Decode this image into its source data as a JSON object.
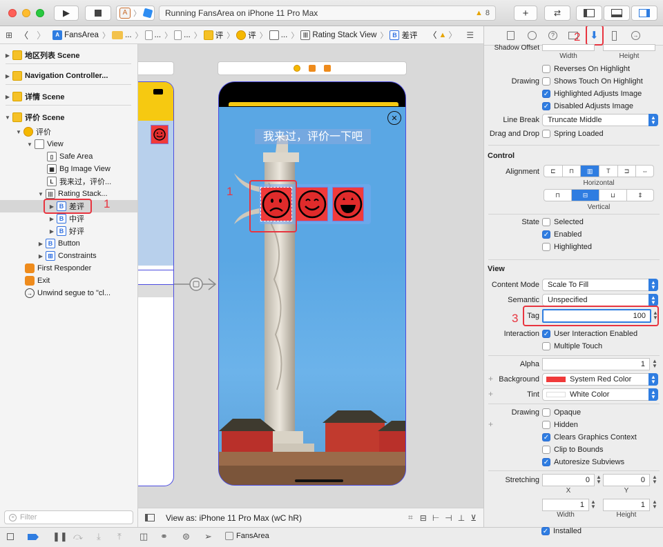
{
  "window": {
    "activity": "Running FansArea on iPhone 11 Pro Max",
    "warning_count": "8"
  },
  "jumpbar": {
    "items": [
      "FansArea",
      "...",
      "...",
      "...",
      "评",
      "评",
      "...",
      "Rating Stack View",
      "差评"
    ]
  },
  "outline": {
    "scenes": [
      "地区列表 Scene",
      "Navigation Controller...",
      "详情 Scene",
      "评价 Scene"
    ],
    "controller": "评价",
    "view": "View",
    "safe_area": "Safe Area",
    "bg_image": "Bg Image View",
    "label": "我来过，评价...",
    "stack": "Rating Stack...",
    "buttons": [
      "差评",
      "中评",
      "好评"
    ],
    "button": "Button",
    "constraints": "Constraints",
    "first_responder": "First Responder",
    "exit": "Exit",
    "unwind": "Unwind segue to \"cl...",
    "filter_placeholder": "Filter"
  },
  "canvas": {
    "view_as": "View as: iPhone 11 Pro Max (wC hR)",
    "title_label": "我来过，评价一下吧",
    "close_glyph": "✕"
  },
  "annotations": [
    "1",
    "1",
    "2",
    "3"
  ],
  "inspector": {
    "top": {
      "shadow_offset": "Shadow Offset",
      "width_cap": "Width",
      "height_cap": "Height"
    },
    "reverses": "Reverses On Highlight",
    "drawing_label": "Drawing",
    "shows_touch": "Shows Touch On Highlight",
    "highlighted_adjusts": "Highlighted Adjusts Image",
    "disabled_adjusts": "Disabled Adjusts Image",
    "line_break_label": "Line Break",
    "line_break": "Truncate Middle",
    "drag_drop_label": "Drag and Drop",
    "spring_loaded": "Spring Loaded",
    "control_title": "Control",
    "alignment_label": "Alignment",
    "horizontal_cap": "Horizontal",
    "vertical_cap": "Vertical",
    "state_label": "State",
    "selected": "Selected",
    "enabled": "Enabled",
    "highlighted": "Highlighted",
    "view_title": "View",
    "content_mode_label": "Content Mode",
    "content_mode": "Scale To Fill",
    "semantic_label": "Semantic",
    "semantic": "Unspecified",
    "tag_label": "Tag",
    "tag": "100",
    "interaction_label": "Interaction",
    "user_interaction": "User Interaction Enabled",
    "multiple_touch": "Multiple Touch",
    "alpha_label": "Alpha",
    "alpha": "1",
    "background_label": "Background",
    "background": "System Red Color",
    "tint_label": "Tint",
    "tint": "White Color",
    "drawing2_label": "Drawing",
    "opaque": "Opaque",
    "hidden": "Hidden",
    "clears": "Clears Graphics Context",
    "clip": "Clip to Bounds",
    "autoresize": "Autoresize Subviews",
    "stretching_label": "Stretching",
    "stretch_x": "0",
    "stretch_y": "0",
    "x_cap": "X",
    "y_cap": "Y",
    "stretch_w": "1",
    "stretch_h": "1",
    "width_cap": "Width",
    "height_cap": "Height",
    "installed": "Installed"
  },
  "statusbar": {
    "target": "FansArea"
  },
  "colors": {
    "accent": "#2f7de1",
    "annotation": "#e8343f",
    "button_red": "#f03a3a"
  }
}
